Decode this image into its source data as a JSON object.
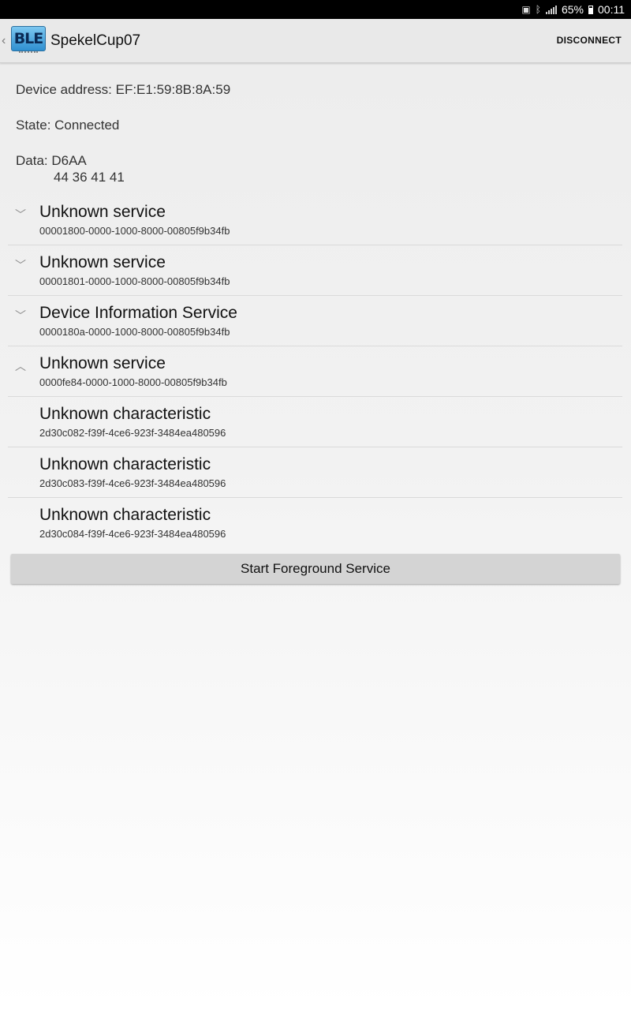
{
  "status_bar": {
    "battery_percent": "65%",
    "time": "00:11",
    "icons": [
      "sim-icon",
      "bluetooth-icon",
      "signal-icon",
      "battery-icon"
    ]
  },
  "action_bar": {
    "logo_text": "BLE",
    "title": "SpekelCup07",
    "disconnect_label": "DISCONNECT"
  },
  "info": {
    "device_address": "Device address: EF:E1:59:8B:8A:59",
    "state": "State: Connected",
    "data_label": "Data: D6AA",
    "data_hex": "44 36 41 41"
  },
  "gatt_items": [
    {
      "kind": "service",
      "expanded": false,
      "name": "Unknown service",
      "uuid": "00001800-0000-1000-8000-00805f9b34fb"
    },
    {
      "kind": "service",
      "expanded": false,
      "name": "Unknown service",
      "uuid": "00001801-0000-1000-8000-00805f9b34fb"
    },
    {
      "kind": "service",
      "expanded": false,
      "name": "Device Information Service",
      "uuid": "0000180a-0000-1000-8000-00805f9b34fb"
    },
    {
      "kind": "service",
      "expanded": true,
      "name": "Unknown service",
      "uuid": "0000fe84-0000-1000-8000-00805f9b34fb"
    },
    {
      "kind": "characteristic",
      "name": "Unknown characteristic",
      "uuid": "2d30c082-f39f-4ce6-923f-3484ea480596"
    },
    {
      "kind": "characteristic",
      "name": "Unknown characteristic",
      "uuid": "2d30c083-f39f-4ce6-923f-3484ea480596"
    },
    {
      "kind": "characteristic",
      "name": "Unknown characteristic",
      "uuid": "2d30c084-f39f-4ce6-923f-3484ea480596"
    }
  ],
  "foreground_button_label": "Start Foreground Service"
}
